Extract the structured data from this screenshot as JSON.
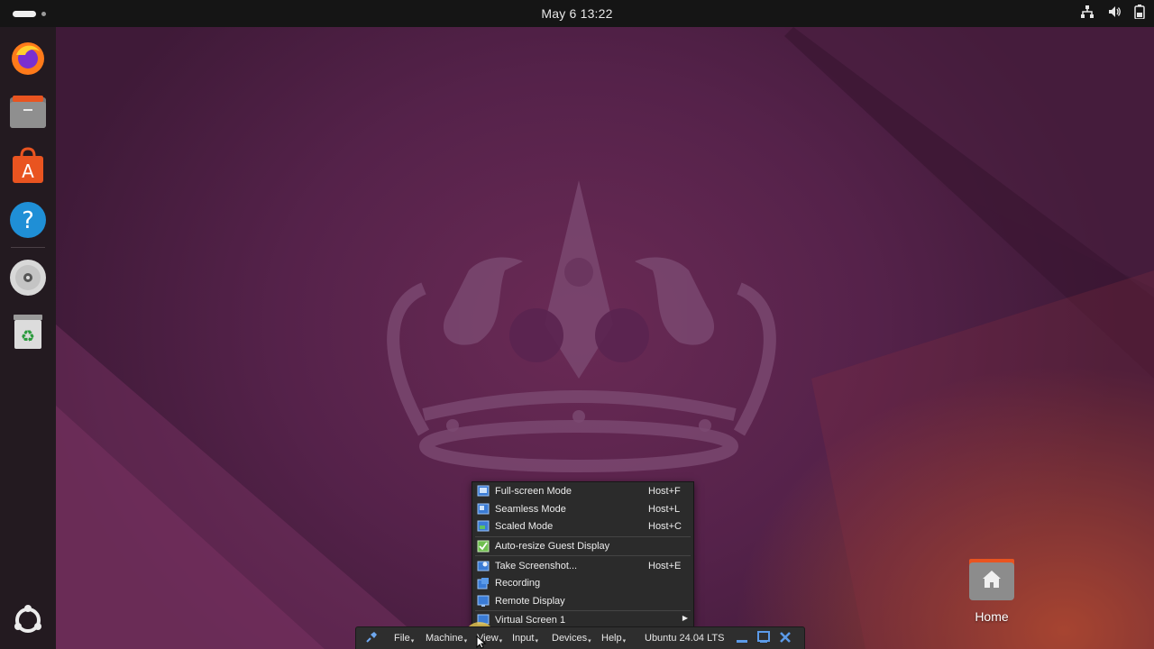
{
  "topbar": {
    "clock": "May 6  13:22",
    "tray_icons": [
      "network-icon",
      "volume-icon",
      "battery-icon"
    ]
  },
  "dock": {
    "items": [
      {
        "name": "firefox-icon",
        "label": "Firefox"
      },
      {
        "name": "files-icon",
        "label": "Files"
      },
      {
        "name": "app-center-icon",
        "label": "App Center"
      },
      {
        "name": "help-icon",
        "label": "Help"
      },
      {
        "name": "optical-disc-icon",
        "label": "Disc"
      },
      {
        "name": "trash-icon",
        "label": "Trash"
      },
      {
        "name": "show-apps-icon",
        "label": "Show Apps"
      }
    ]
  },
  "desktop": {
    "home_label": "Home"
  },
  "vbox_toolbar": {
    "menus": [
      "File",
      "Machine",
      "View",
      "Input",
      "Devices",
      "Help"
    ],
    "vm_name": "Ubuntu 24.04 LTS"
  },
  "view_menu": {
    "items": [
      {
        "label": "Full-screen Mode",
        "shortcut": "Host+F"
      },
      {
        "label": "Seamless Mode",
        "shortcut": "Host+L"
      },
      {
        "label": "Scaled Mode",
        "shortcut": "Host+C"
      },
      {
        "label": "Auto-resize Guest Display",
        "shortcut": ""
      },
      {
        "label": "Take Screenshot...",
        "shortcut": "Host+E"
      },
      {
        "label": "Recording",
        "shortcut": ""
      },
      {
        "label": "Remote Display",
        "shortcut": ""
      },
      {
        "label": "Virtual Screen 1",
        "shortcut": ""
      }
    ]
  },
  "colors": {
    "accent": "#e95420",
    "wallpaper": "#55224a",
    "menu_bg": "#2b2b2b"
  }
}
